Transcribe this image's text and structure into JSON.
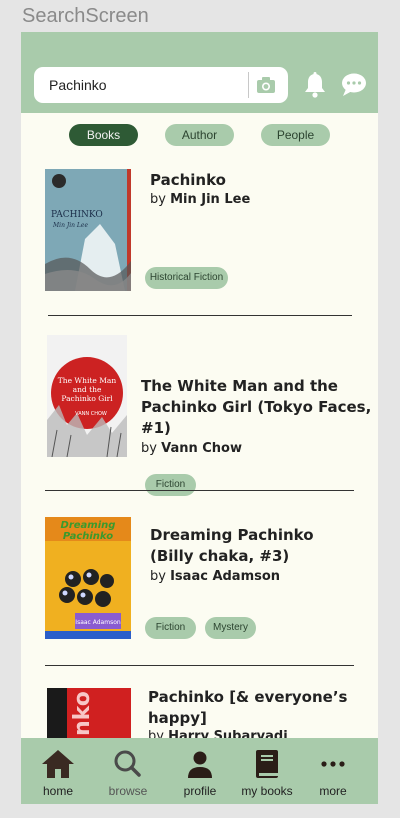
{
  "screen_label": "SearchScreen",
  "header": {
    "search_value": "Pachinko"
  },
  "filters": {
    "books": "Books",
    "author": "Author",
    "people": "People",
    "active": "Books"
  },
  "books": [
    {
      "title_lines": [
        "Pachinko"
      ],
      "by": "by",
      "author": "Min Jin Lee",
      "tags": [
        "Historical Fiction"
      ],
      "cover_text": [
        "PACHINKO",
        "Min Jin Lee"
      ]
    },
    {
      "title_lines": [
        "The White Man and the",
        "Pachinko Girl (Tokyo Faces,",
        "#1)"
      ],
      "by": "by",
      "author": "Vann Chow",
      "tags": [
        "Fiction"
      ],
      "cover_text": [
        "The White Man",
        "and the",
        "Pachinko Girl",
        "VANN CHOW"
      ]
    },
    {
      "title_lines": [
        "Dreaming Pachinko",
        "(Billy chaka, #3)"
      ],
      "by": "by",
      "author": "Isaac Adamson",
      "tags": [
        "Fiction",
        "Mystery"
      ],
      "cover_text": [
        "Dreaming",
        "Pachinko",
        "Isaac Adamson"
      ]
    },
    {
      "title_lines": [
        "Pachinko [& everyone’s",
        "happy]"
      ],
      "by": "by",
      "author": "Harry Subarvadi",
      "tags": [],
      "cover_text": [
        "nko"
      ]
    }
  ],
  "bottom_nav": {
    "home": "home",
    "browse": "browse",
    "profile": "profile",
    "my_books": "my books",
    "more": "more"
  },
  "colors": {
    "header_green": "#a9cbab",
    "active_green": "#2e5a35",
    "background": "#fcfcf2"
  }
}
